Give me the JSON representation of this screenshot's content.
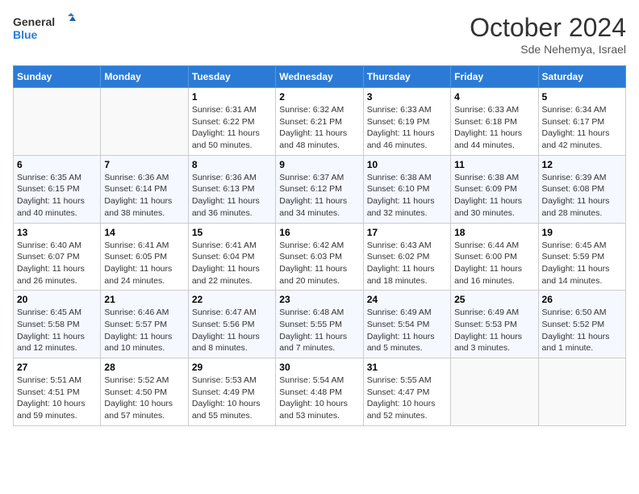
{
  "header": {
    "logo_line1": "General",
    "logo_line2": "Blue",
    "month_year": "October 2024",
    "location": "Sde Nehemya, Israel"
  },
  "weekdays": [
    "Sunday",
    "Monday",
    "Tuesday",
    "Wednesday",
    "Thursday",
    "Friday",
    "Saturday"
  ],
  "weeks": [
    [
      {
        "day": "",
        "info": ""
      },
      {
        "day": "",
        "info": ""
      },
      {
        "day": "1",
        "info": "Sunrise: 6:31 AM\nSunset: 6:22 PM\nDaylight: 11 hours and 50 minutes."
      },
      {
        "day": "2",
        "info": "Sunrise: 6:32 AM\nSunset: 6:21 PM\nDaylight: 11 hours and 48 minutes."
      },
      {
        "day": "3",
        "info": "Sunrise: 6:33 AM\nSunset: 6:19 PM\nDaylight: 11 hours and 46 minutes."
      },
      {
        "day": "4",
        "info": "Sunrise: 6:33 AM\nSunset: 6:18 PM\nDaylight: 11 hours and 44 minutes."
      },
      {
        "day": "5",
        "info": "Sunrise: 6:34 AM\nSunset: 6:17 PM\nDaylight: 11 hours and 42 minutes."
      }
    ],
    [
      {
        "day": "6",
        "info": "Sunrise: 6:35 AM\nSunset: 6:15 PM\nDaylight: 11 hours and 40 minutes."
      },
      {
        "day": "7",
        "info": "Sunrise: 6:36 AM\nSunset: 6:14 PM\nDaylight: 11 hours and 38 minutes."
      },
      {
        "day": "8",
        "info": "Sunrise: 6:36 AM\nSunset: 6:13 PM\nDaylight: 11 hours and 36 minutes."
      },
      {
        "day": "9",
        "info": "Sunrise: 6:37 AM\nSunset: 6:12 PM\nDaylight: 11 hours and 34 minutes."
      },
      {
        "day": "10",
        "info": "Sunrise: 6:38 AM\nSunset: 6:10 PM\nDaylight: 11 hours and 32 minutes."
      },
      {
        "day": "11",
        "info": "Sunrise: 6:38 AM\nSunset: 6:09 PM\nDaylight: 11 hours and 30 minutes."
      },
      {
        "day": "12",
        "info": "Sunrise: 6:39 AM\nSunset: 6:08 PM\nDaylight: 11 hours and 28 minutes."
      }
    ],
    [
      {
        "day": "13",
        "info": "Sunrise: 6:40 AM\nSunset: 6:07 PM\nDaylight: 11 hours and 26 minutes."
      },
      {
        "day": "14",
        "info": "Sunrise: 6:41 AM\nSunset: 6:05 PM\nDaylight: 11 hours and 24 minutes."
      },
      {
        "day": "15",
        "info": "Sunrise: 6:41 AM\nSunset: 6:04 PM\nDaylight: 11 hours and 22 minutes."
      },
      {
        "day": "16",
        "info": "Sunrise: 6:42 AM\nSunset: 6:03 PM\nDaylight: 11 hours and 20 minutes."
      },
      {
        "day": "17",
        "info": "Sunrise: 6:43 AM\nSunset: 6:02 PM\nDaylight: 11 hours and 18 minutes."
      },
      {
        "day": "18",
        "info": "Sunrise: 6:44 AM\nSunset: 6:00 PM\nDaylight: 11 hours and 16 minutes."
      },
      {
        "day": "19",
        "info": "Sunrise: 6:45 AM\nSunset: 5:59 PM\nDaylight: 11 hours and 14 minutes."
      }
    ],
    [
      {
        "day": "20",
        "info": "Sunrise: 6:45 AM\nSunset: 5:58 PM\nDaylight: 11 hours and 12 minutes."
      },
      {
        "day": "21",
        "info": "Sunrise: 6:46 AM\nSunset: 5:57 PM\nDaylight: 11 hours and 10 minutes."
      },
      {
        "day": "22",
        "info": "Sunrise: 6:47 AM\nSunset: 5:56 PM\nDaylight: 11 hours and 8 minutes."
      },
      {
        "day": "23",
        "info": "Sunrise: 6:48 AM\nSunset: 5:55 PM\nDaylight: 11 hours and 7 minutes."
      },
      {
        "day": "24",
        "info": "Sunrise: 6:49 AM\nSunset: 5:54 PM\nDaylight: 11 hours and 5 minutes."
      },
      {
        "day": "25",
        "info": "Sunrise: 6:49 AM\nSunset: 5:53 PM\nDaylight: 11 hours and 3 minutes."
      },
      {
        "day": "26",
        "info": "Sunrise: 6:50 AM\nSunset: 5:52 PM\nDaylight: 11 hours and 1 minute."
      }
    ],
    [
      {
        "day": "27",
        "info": "Sunrise: 5:51 AM\nSunset: 4:51 PM\nDaylight: 10 hours and 59 minutes."
      },
      {
        "day": "28",
        "info": "Sunrise: 5:52 AM\nSunset: 4:50 PM\nDaylight: 10 hours and 57 minutes."
      },
      {
        "day": "29",
        "info": "Sunrise: 5:53 AM\nSunset: 4:49 PM\nDaylight: 10 hours and 55 minutes."
      },
      {
        "day": "30",
        "info": "Sunrise: 5:54 AM\nSunset: 4:48 PM\nDaylight: 10 hours and 53 minutes."
      },
      {
        "day": "31",
        "info": "Sunrise: 5:55 AM\nSunset: 4:47 PM\nDaylight: 10 hours and 52 minutes."
      },
      {
        "day": "",
        "info": ""
      },
      {
        "day": "",
        "info": ""
      }
    ]
  ]
}
